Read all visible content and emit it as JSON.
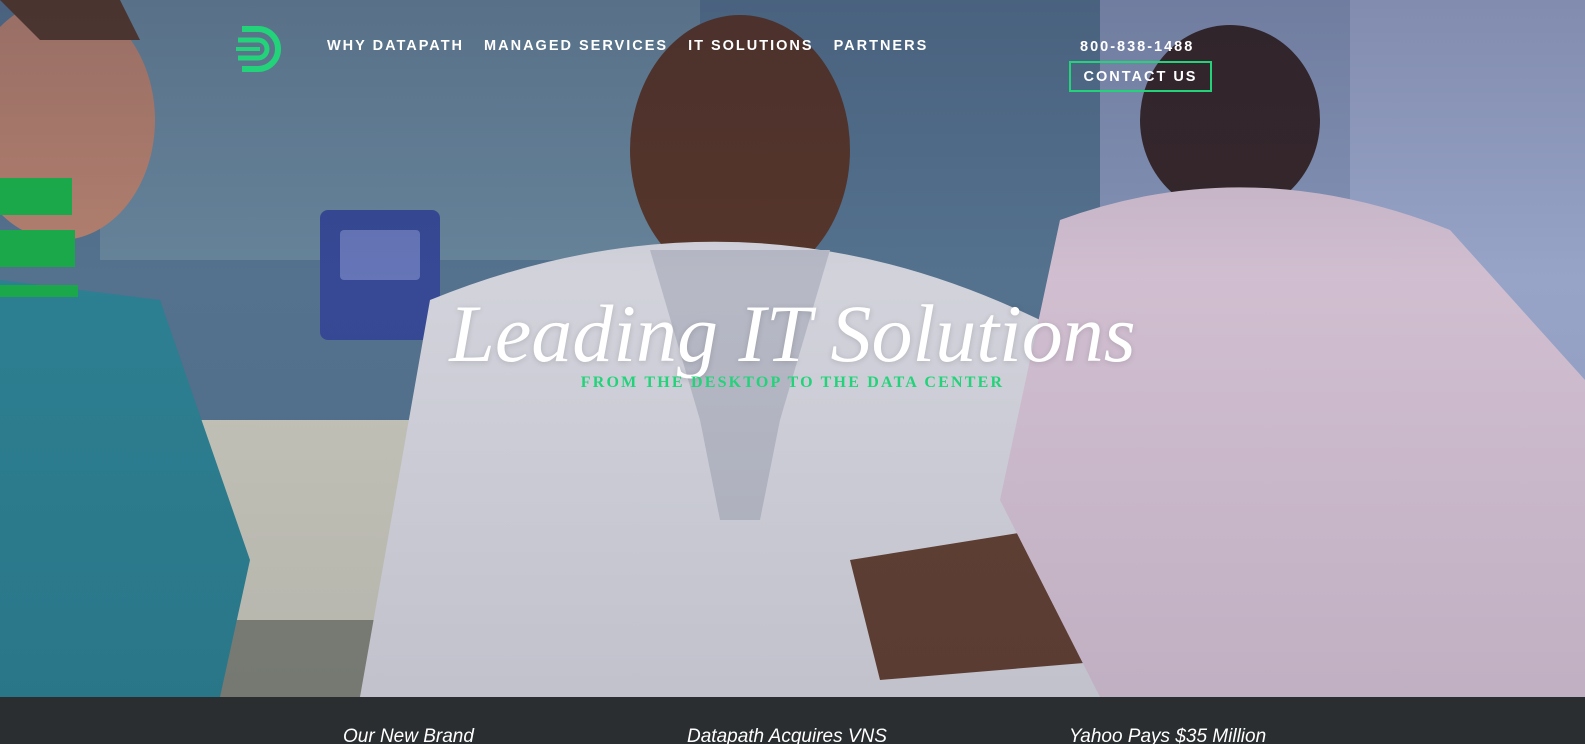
{
  "header": {
    "logo_icon": "datapath-d-logo",
    "nav": [
      {
        "label": "WHY DATAPATH"
      },
      {
        "label": "MANAGED SERVICES"
      },
      {
        "label": "IT SOLUTIONS"
      },
      {
        "label": "PARTNERS"
      }
    ],
    "phone": "800-838-1488",
    "contact_label": "CONTACT US"
  },
  "hero": {
    "title": "Leading IT Solutions",
    "subtitle": "FROM THE DESKTOP TO THE DATA CENTER"
  },
  "news": [
    {
      "label": "Our New Brand"
    },
    {
      "label": "Datapath Acquires VNS"
    },
    {
      "label": "Yahoo Pays $35 Million"
    }
  ],
  "colors": {
    "accent": "#22d37a",
    "news_bar": "#2a2e30",
    "stripe": "#1aa84a"
  }
}
